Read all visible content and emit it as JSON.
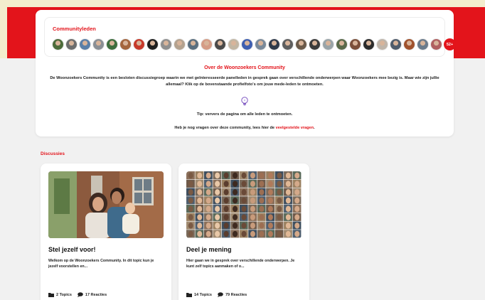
{
  "members": {
    "title": "Communityleden",
    "more_count": "52+",
    "avatar_colors": [
      "#4c6b3a",
      "#6d6d6d",
      "#5a7fa8",
      "#8a8f95",
      "#3e6e3e",
      "#a4653d",
      "#c73a2b",
      "#1f1f1f",
      "#8f8f8f",
      "#b4a28f",
      "#5b6f7f",
      "#d59c86",
      "#4a4a4a",
      "#c2b6a3",
      "#3f5fb0",
      "#7a8a9a",
      "#2f3a4a",
      "#5e5e5e",
      "#6b5a4a",
      "#3b3b3b",
      "#9aa4a8",
      "#5a6a4a",
      "#7b4f3a",
      "#2c2c2c",
      "#bfb5aa",
      "#4f5c6b",
      "#a0522d",
      "#6b7b8b",
      "#b06060"
    ]
  },
  "about": {
    "title": "Over de Woonzoekers Community",
    "description": "De Woonzoekers Community is een besloten discussiegroep waarin we met geïnteresseerde panelleden in gesprek gaan over verschillende onderwerpen waar Woonzoekers mee bezig is. Maar wie zijn jullie allemaal? Klik op de bovenstaande profielfoto's om jouw mede-leden te ontmoeten.",
    "tip": "Tip: ververs de pagina om alle leden te ontmoeten.",
    "faq_prefix": "Heb je nog vragen over deze community, lees hier de ",
    "faq_link": "veelgestelde vragen",
    "faq_suffix": "."
  },
  "discussions": {
    "title": "Discussies",
    "cards": [
      {
        "title": "Stel jezelf voor!",
        "text": "Welkom op de Woonzoekers Community. In dit topic kun je jezelf voorstellen en...",
        "topics": "2 Topics",
        "reactions": "17 Reacties"
      },
      {
        "title": "Deel je mening",
        "text": "Hier gaan we in gesprek over verschillende onderwerpen. Je kunt zelf topics aanmaken of o...",
        "topics": "14 Topics",
        "reactions": "79 Reacties"
      }
    ]
  },
  "colors": {
    "brand_red": "#e3141b",
    "band_cream": "#f3edce",
    "background": "#f1f1f1"
  },
  "icons": {
    "bulb": "lightbulb-icon",
    "folder": "folder-icon",
    "chat": "chat-bubble-icon"
  }
}
